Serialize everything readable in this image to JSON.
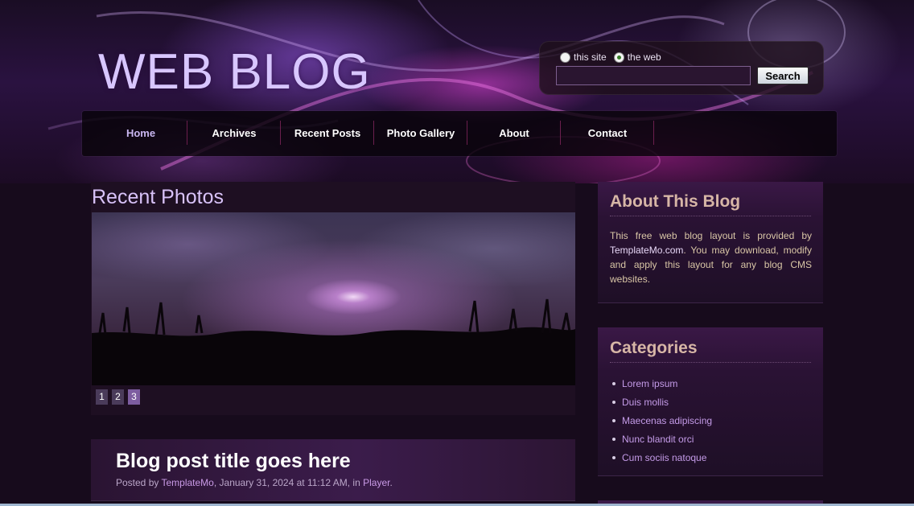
{
  "header": {
    "site_title": "WEB BLOG"
  },
  "search": {
    "option_site": "this site",
    "option_web": "the web",
    "selected_option": "the web",
    "query": "",
    "button_label": "Search"
  },
  "nav": {
    "items": [
      {
        "label": "Home"
      },
      {
        "label": "Archives"
      },
      {
        "label": "Recent Posts"
      },
      {
        "label": "Photo Gallery"
      },
      {
        "label": "About"
      },
      {
        "label": "Contact"
      }
    ]
  },
  "photos": {
    "heading": "Recent Photos",
    "pages": [
      "1",
      "2",
      "3"
    ],
    "current_page": "3"
  },
  "post": {
    "title": "Blog post title goes here",
    "meta_prefix": "Posted by ",
    "author": "TemplateMo",
    "meta_date": ", January 31, 2024 at 11:12 AM, in ",
    "category": "Player",
    "meta_end": "."
  },
  "sidebar": {
    "about": {
      "heading": "About This Blog",
      "text_before": "This free web blog layout is provided by ",
      "link": "TemplateMo.com",
      "text_after": ". You may download, modify and apply this layout for any blog CMS websites."
    },
    "categories": {
      "heading": "Categories",
      "items": [
        "Lorem ipsum",
        "Duis mollis",
        "Maecenas adipiscing",
        "Nunc blandit orci",
        "Cum sociis natoque"
      ]
    }
  },
  "colors": {
    "background": "#170b1c",
    "title": "#d8c6ff",
    "heading_accent": "#d7b6a6",
    "link": "#c49be8"
  }
}
